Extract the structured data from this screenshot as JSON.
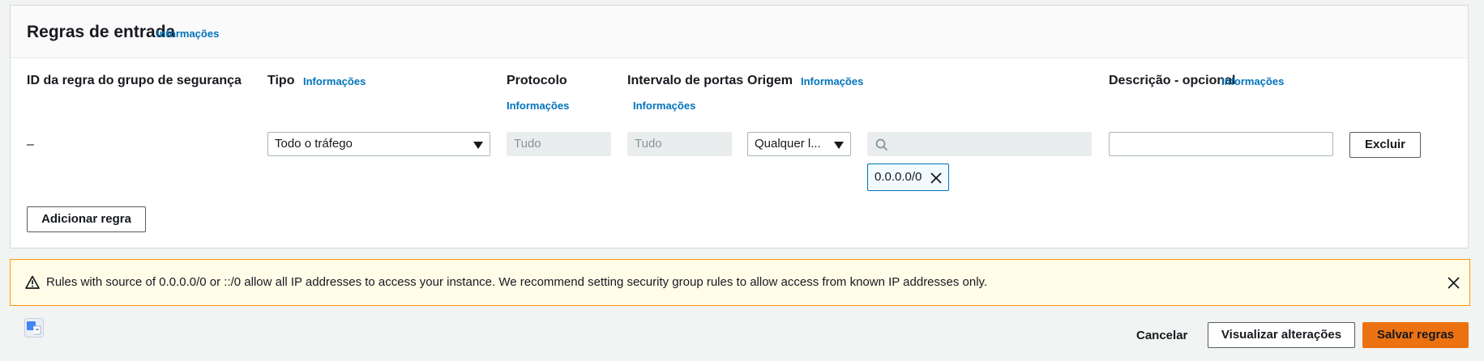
{
  "panel": {
    "title": "Regras de entrada",
    "title_info": "Informações"
  },
  "columns": {
    "rule_id": "ID da regra do grupo de segurança",
    "type": "Tipo",
    "type_info": "Informações",
    "protocol": "Protocolo",
    "protocol_info": "Informações",
    "port_range": "Intervalo de portas",
    "port_range_info": "Informações",
    "origin": "Origem",
    "origin_info": "Informações",
    "description": "Descrição - opcional",
    "description_info": "Informações"
  },
  "rule": {
    "id": "–",
    "type_value": "Todo o tráfego",
    "protocol_value": "Tudo",
    "port_range_value": "Tudo",
    "origin_value": "Qualquer l...",
    "origin_search_value": "",
    "origin_token": "0.0.0.0/0",
    "description_value": "",
    "delete_label": "Excluir"
  },
  "add_rule_label": "Adicionar regra",
  "warning": {
    "text": "Rules with source of 0.0.0.0/0 or ::/0 allow all IP addresses to access your instance. We recommend setting security group rules to allow access from known IP addresses only."
  },
  "footer": {
    "cancel_label": "Cancelar",
    "preview_label": "Visualizar alterações",
    "save_label": "Salvar regras"
  },
  "colors": {
    "link": "#0073bb",
    "primary": "#ec7211",
    "warning_border": "#ff9900",
    "warning_bg": "#fffce8"
  },
  "icons": [
    "search-icon",
    "close-icon",
    "warning-icon",
    "dismiss-icon",
    "translate-icon",
    "caret-down-icon"
  ]
}
